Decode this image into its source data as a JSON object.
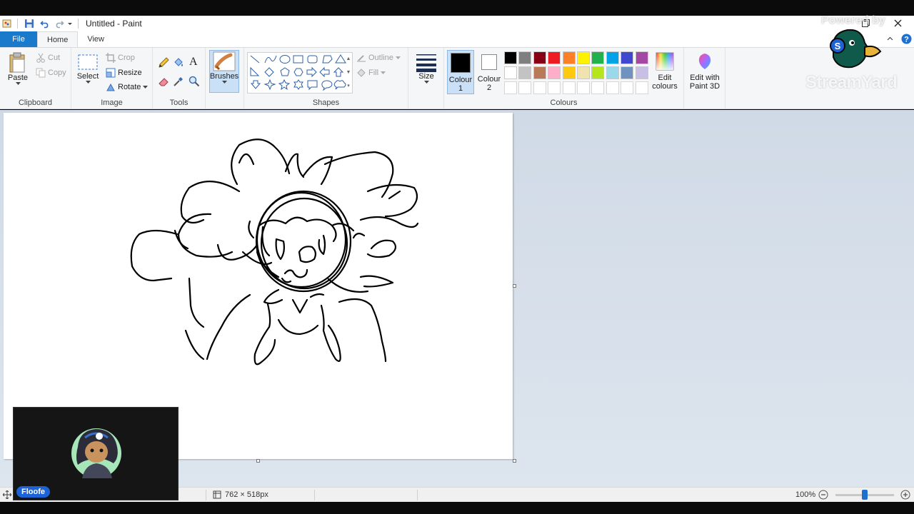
{
  "window": {
    "title": "Untitled - Paint"
  },
  "tabs": {
    "file": "File",
    "home": "Home",
    "view": "View"
  },
  "clipboard": {
    "paste": "Paste",
    "cut": "Cut",
    "copy": "Copy",
    "label": "Clipboard"
  },
  "image": {
    "select": "Select",
    "crop": "Crop",
    "resize": "Resize",
    "rotate": "Rotate",
    "label": "Image"
  },
  "tools": {
    "label": "Tools",
    "text_tool": "A"
  },
  "brushes": {
    "label": "Brushes"
  },
  "shapes": {
    "outline": "Outline",
    "fill": "Fill",
    "label": "Shapes"
  },
  "size": {
    "label": "Size"
  },
  "colours": {
    "colour1_label_1": "Colour",
    "colour1_label_2": "1",
    "colour2_label_1": "Colour",
    "colour2_label_2": "2",
    "colour1": "#000000",
    "colour2": "#ffffff",
    "palette_row1": [
      "#000000",
      "#7f7f7f",
      "#880015",
      "#ed1c24",
      "#ff7f27",
      "#fff200",
      "#22b14c",
      "#00a2e8",
      "#3f48cc",
      "#a349a4"
    ],
    "palette_row2": [
      "#ffffff",
      "#c3c3c3",
      "#b97a57",
      "#ffaec9",
      "#ffc90e",
      "#efe4b0",
      "#b5e61d",
      "#99d9ea",
      "#7092be",
      "#c8bfe7"
    ],
    "edit_colours_1": "Edit",
    "edit_colours_2": "colours",
    "label": "Colours"
  },
  "paint3d": {
    "label_1": "Edit with",
    "label_2": "Paint 3D"
  },
  "status": {
    "dimensions": "762 × 518px",
    "zoom": "100%"
  },
  "overlay": {
    "powered_by": "Powered by",
    "brand": "StreamYard",
    "participant_name": "Floofe"
  }
}
